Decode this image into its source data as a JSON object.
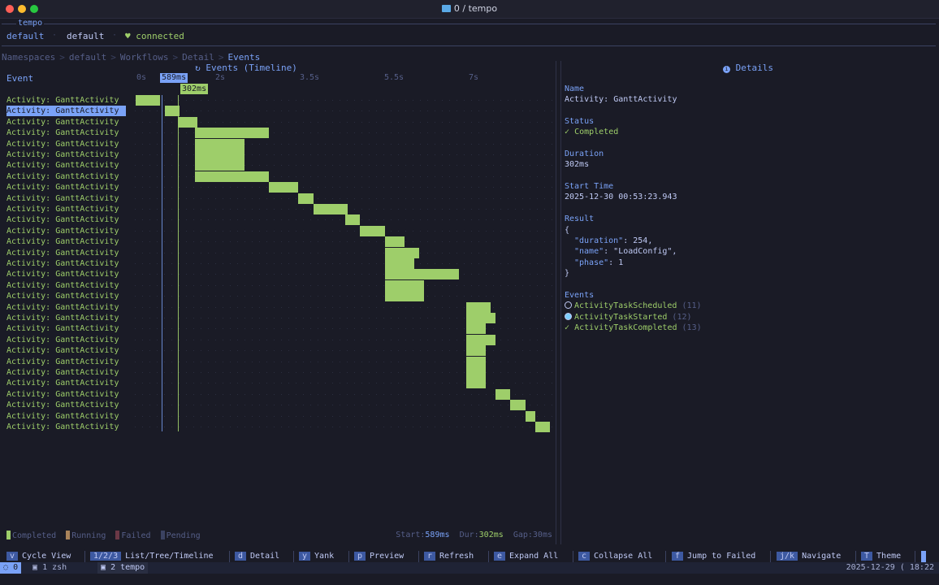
{
  "window": {
    "title": "0 / tempo"
  },
  "context": {
    "legend": "tempo",
    "namespace": "default",
    "cluster": "default",
    "status": "connected"
  },
  "breadcrumb": [
    "Namespaces",
    "default",
    "Workflows",
    "Detail",
    "Events"
  ],
  "events_panel": {
    "title": "Events (Timeline)",
    "column_label": "Event",
    "ticks": [
      "0s",
      "2s",
      "3.5s",
      "5.5s",
      "7s"
    ],
    "cursor_label": "589ms",
    "duration_label": "302ms",
    "row_label": "Activity: GanttActivity",
    "selected_index": 1,
    "legend": {
      "completed": "Completed",
      "running": "Running",
      "failed": "Failed",
      "pending": "Pending"
    },
    "stats": {
      "start_label": "Start:",
      "start": "589ms",
      "dur_label": "Dur:",
      "dur": "302ms",
      "gap_label": "Gap:",
      "gap": "30ms"
    }
  },
  "chart_data": {
    "type": "bar",
    "title": "Events (Timeline)",
    "xlabel": "",
    "ylabel": "Event",
    "x_ticks": [
      "0s",
      "2s",
      "3.5s",
      "5.5s",
      "7s"
    ],
    "xlim": [
      0,
      8.5
    ],
    "series": [
      {
        "start_s": [
          0,
          0.589,
          0.86,
          1.2,
          1.2,
          1.2,
          1.2,
          1.2,
          2.7,
          3.3,
          3.6,
          4.25,
          4.55,
          5.05,
          5.05,
          5.05,
          5.05,
          5.05,
          5.05,
          6.7,
          6.7,
          6.7,
          6.7,
          6.7,
          6.7,
          6.7,
          6.7,
          7.3,
          7.6,
          7.9,
          8.1
        ],
        "duration_s": [
          0.5,
          0.302,
          0.4,
          1.5,
          1.0,
          1.0,
          1.0,
          1.5,
          0.6,
          0.3,
          0.7,
          0.3,
          0.5,
          0.4,
          0.7,
          0.6,
          1.5,
          0.8,
          0.8,
          0.5,
          0.6,
          0.4,
          0.6,
          0.4,
          0.4,
          0.4,
          0.4,
          0.3,
          0.3,
          0.2,
          0.3
        ]
      }
    ],
    "categories": [
      "Activity: GanttActivity"
    ],
    "legend": [
      "Completed",
      "Running",
      "Failed",
      "Pending"
    ],
    "legend_position": "bottom-left",
    "colors": {
      "completed": "#9ece6a",
      "running": "#a9835a",
      "failed": "#6b3846",
      "pending": "#3b4261"
    }
  },
  "details": {
    "title": "Details",
    "name_label": "Name",
    "name": "Activity: GanttActivity",
    "status_label": "Status",
    "status": "Completed",
    "duration_label": "Duration",
    "duration": "302ms",
    "start_label": "Start Time",
    "start": "2025-12-30 00:53:23.943",
    "result_label": "Result",
    "result": {
      "open": "{",
      "close": "}",
      "k1": "\"duration\"",
      "v1": "254,",
      "k2": "\"name\"",
      "v2": "\"LoadConfig\",",
      "k3": "\"phase\"",
      "v3": "1"
    },
    "events_label": "Events",
    "events": [
      {
        "name": "ActivityTaskScheduled",
        "id": "(11)"
      },
      {
        "name": "ActivityTaskStarted",
        "id": "(12)"
      },
      {
        "name": "ActivityTaskCompleted",
        "id": "(13)"
      }
    ]
  },
  "hotkeys": [
    {
      "key": "v",
      "desc": "Cycle View"
    },
    {
      "key": "1/2/3",
      "desc": "List/Tree/Timeline"
    },
    {
      "key": "d",
      "desc": "Detail"
    },
    {
      "key": "y",
      "desc": "Yank"
    },
    {
      "key": "p",
      "desc": "Preview"
    },
    {
      "key": "r",
      "desc": "Refresh"
    },
    {
      "key": "e",
      "desc": "Expand All"
    },
    {
      "key": "c",
      "desc": "Collapse All"
    },
    {
      "key": "f",
      "desc": "Jump to Failed"
    },
    {
      "key": "j/k",
      "desc": "Navigate"
    },
    {
      "key": "T",
      "desc": "Theme"
    }
  ],
  "tmux": {
    "session": "0",
    "win1": "1 zsh",
    "win2": "2 tempo",
    "datetime": "2025-12-29 ( 18:22"
  }
}
